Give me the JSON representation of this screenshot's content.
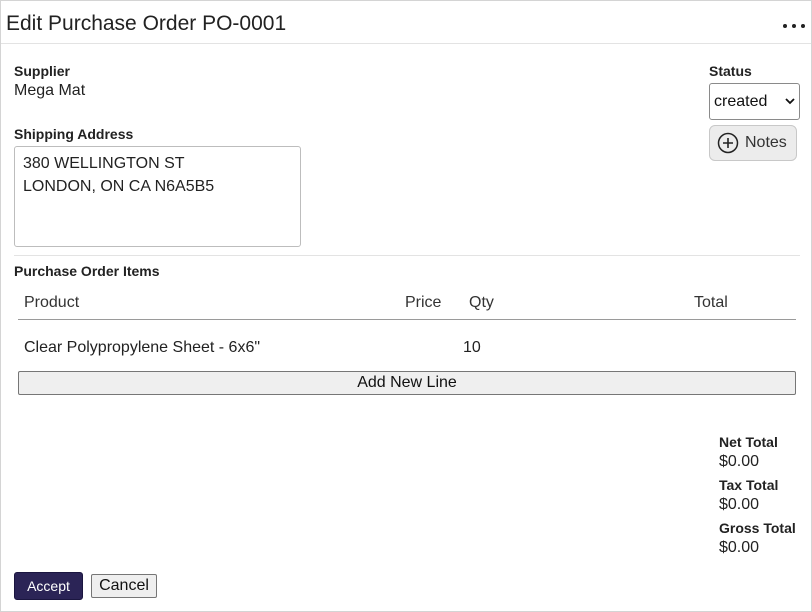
{
  "header": {
    "title": "Edit Purchase Order PO-0001",
    "more_icon": "more-horizontal-icon"
  },
  "supplier": {
    "label": "Supplier",
    "value": "Mega Mat"
  },
  "shipping": {
    "label": "Shipping Address",
    "line1": "380 WELLINGTON ST",
    "line2": "LONDON, ON CA N6A5B5"
  },
  "status": {
    "label": "Status",
    "selected": "created"
  },
  "notes": {
    "label": "Notes",
    "icon": "plus-circle-icon"
  },
  "items": {
    "section_label": "Purchase Order Items",
    "columns": [
      "Product",
      "Price",
      "Qty",
      "Total"
    ],
    "rows": [
      {
        "product": "Clear Polypropylene Sheet - 6x6\"",
        "price": "",
        "qty": "10",
        "total": ""
      }
    ],
    "add_line_label": "Add New Line"
  },
  "totals": {
    "net_label": "Net Total",
    "net_value": "$0.00",
    "tax_label": "Tax Total",
    "tax_value": "$0.00",
    "gross_label": "Gross Total",
    "gross_value": "$0.00"
  },
  "actions": {
    "accept_label": "Accept",
    "cancel_label": "Cancel"
  },
  "colors": {
    "accent": "#2b2456",
    "border": "#bdbdbd"
  }
}
